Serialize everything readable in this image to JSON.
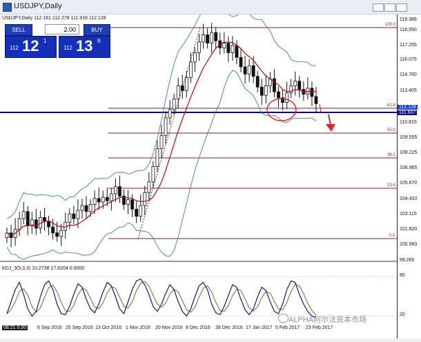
{
  "window": {
    "title": "USDJPY,Daily"
  },
  "symbol_bar": "USDJPY,Daily  112.181 112.278 111.918 112.128",
  "trade_panel": {
    "sell_label": "SELL",
    "buy_label": "BUY",
    "lot": "2.00",
    "sell_quote": {
      "prefix": "112",
      "big": "12",
      "sup": "1"
    },
    "buy_quote": {
      "prefix": "112",
      "big": "13",
      "sup": "9"
    }
  },
  "price_axis": [
    "119.386",
    "118.550",
    "117.255",
    "116.075",
    "114.760",
    "113.405",
    "111.607",
    "110.815",
    "109.555",
    "108.225",
    "106.965",
    "105.670",
    "104.410",
    "103.115",
    "101.820",
    "100.560",
    "99.265"
  ],
  "price_boxes": {
    "current": "112.128",
    "line": "111.607"
  },
  "fib_levels": [
    "100.0",
    "61.8",
    "50.0",
    "38.2",
    "23.6",
    "0.0"
  ],
  "stoch_label": "KDJ_3(5,3,3) 10.2738 17.6204 0.0000",
  "stoch_axis": [
    "80",
    "20"
  ],
  "date_labels": [
    "08.21 0.00",
    "6 Sep 2016",
    "25 Sep 2016",
    "13 Oct 2016",
    "1 Nov 2016",
    "20 Nov 2016",
    "8 Dec 2016",
    "28 Dec 2016",
    "17 Jan 2017",
    "5 Feb 2017",
    "23 Feb 2017"
  ],
  "watermark": "ALPHA阿尔法资本市场",
  "colors": {
    "candle": "#111111",
    "ma": "#b01818",
    "bands": "#3a7f9a",
    "fib": "#7a1f2d",
    "support": "#0a0a7a",
    "accent": "#d9262b"
  },
  "chart_data": {
    "type": "candlestick",
    "title": "USDJPY,Daily",
    "ylim": [
      99.265,
      119.386
    ],
    "close_series": [
      101.2,
      100.8,
      101.5,
      102.4,
      103.0,
      101.8,
      102.3,
      101.6,
      102.5,
      102.2,
      101.7,
      101.2,
      100.9,
      101.4,
      102.1,
      102.8,
      102.4,
      103.1,
      103.5,
      103.0,
      103.6,
      104.1,
      103.8,
      104.2,
      103.9,
      104.5,
      105.1,
      104.3,
      103.6,
      104.0,
      103.2,
      102.6,
      103.5,
      104.6,
      105.5,
      106.8,
      108.3,
      109.4,
      110.9,
      111.6,
      112.5,
      113.6,
      113.2,
      114.3,
      115.6,
      116.4,
      117.3,
      117.9,
      117.2,
      118.1,
      117.4,
      116.8,
      117.2,
      116.4,
      117.0,
      116.0,
      115.2,
      114.6,
      115.3,
      114.4,
      113.5,
      112.8,
      113.6,
      114.2,
      113.1,
      112.6,
      112.2,
      113.0,
      113.6,
      114.0,
      113.3,
      112.9,
      113.4,
      112.7,
      112.1
    ],
    "fib_values": [
      100.0,
      61.8,
      50.0,
      38.2,
      23.6,
      0.0
    ],
    "support_line": 111.607,
    "stochastic": [
      20,
      45,
      70,
      85,
      60,
      30,
      15,
      25,
      55,
      80,
      88,
      70,
      40,
      20,
      18,
      35,
      60,
      82,
      75,
      50,
      30,
      22,
      40,
      65,
      85,
      78,
      55,
      30,
      20,
      45,
      70,
      88,
      92,
      80,
      60,
      35,
      25,
      40,
      62,
      80,
      70,
      45,
      25,
      15,
      30,
      55,
      78,
      85,
      70,
      40,
      22,
      18,
      35,
      58,
      80,
      75,
      50,
      28,
      18,
      30,
      55,
      75,
      68,
      45,
      25,
      20,
      40,
      70,
      88,
      85,
      60,
      40,
      25,
      15,
      12
    ]
  }
}
